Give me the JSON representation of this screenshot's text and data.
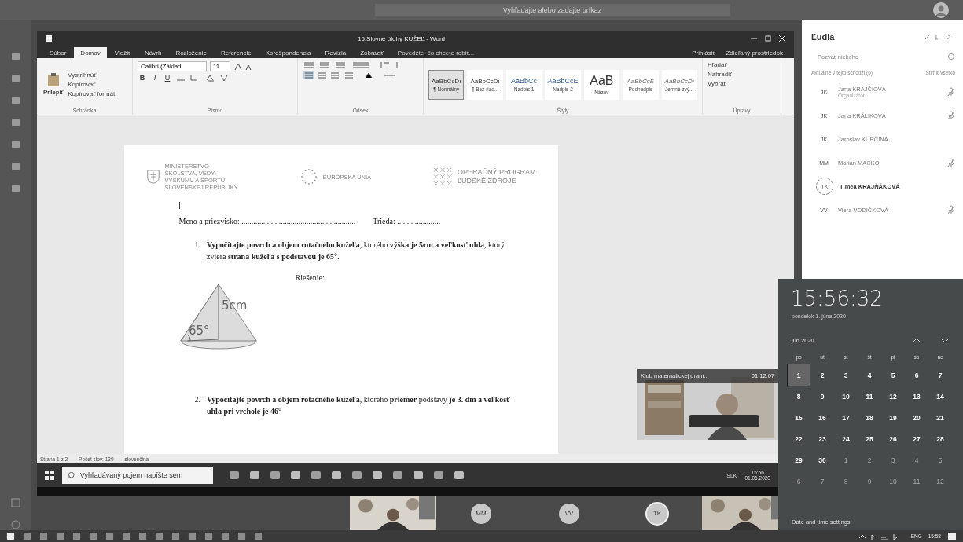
{
  "teams_bar": {
    "search": {
      "placeholder": "Vyhľadajte alebo zadajte príkaz"
    }
  },
  "word": {
    "title": "16.Slovné úlohy KUŽEĽ - Word",
    "tabs": [
      {
        "label": "Súbor",
        "selected": false
      },
      {
        "label": "Domov",
        "selected": true
      },
      {
        "label": "Vložiť",
        "selected": false
      },
      {
        "label": "Návrh",
        "selected": false
      },
      {
        "label": "Rozloženie",
        "selected": false
      },
      {
        "label": "Referencie",
        "selected": false
      },
      {
        "label": "Korešpondencia",
        "selected": false
      },
      {
        "label": "Revízia",
        "selected": false
      },
      {
        "label": "Zobraziť",
        "selected": false
      }
    ],
    "tell_me": "Povedzte, čo chcete robiť...",
    "sign_in": "Prihlásiť",
    "share": "Zdieľaný prostriedok",
    "clipboard": {
      "paste": "Prilepiť",
      "items": [
        "Vystrihnúť",
        "Kopírovať",
        "Kopírovať formát"
      ],
      "label": "Schránka"
    },
    "font": {
      "name": "Calibri (Základ",
      "size": "11",
      "format_buttons": [
        "B",
        "I",
        "U"
      ],
      "label": "Písmo"
    },
    "paragraph": {
      "label": "Odsek"
    },
    "styles": {
      "label": "Štýly",
      "items": [
        {
          "preview": "AaBbCcDı",
          "name": "¶ Normálny",
          "selected": true
        },
        {
          "preview": "AaBbCcDı",
          "name": "¶ Bez riad...",
          "selected": false
        },
        {
          "preview": "AaBbCc",
          "name": "Nadpis 1",
          "selected": false
        },
        {
          "preview": "AaBbCcE",
          "name": "Nadpis 2",
          "selected": false
        },
        {
          "preview": "AaB",
          "name": "Názov",
          "selected": false
        },
        {
          "preview": "AaBbCcE",
          "name": "Podnadpis",
          "selected": false
        },
        {
          "preview": "AaBbCcDı",
          "name": "Jemné zvý...",
          "selected": false
        }
      ]
    },
    "editing": {
      "label": "Úpravy",
      "items": [
        "Hľadať",
        "Nahradiť",
        "Vybrať"
      ]
    }
  },
  "document": {
    "logos": [
      {
        "kind": "ministry",
        "lines": [
          "MINISTERSTVO",
          "ŠKOLSTVA, VEDY,",
          "VÝSKUMU A ŠPORTU",
          "SLOVENSKEJ REPUBLIKY"
        ]
      },
      {
        "kind": "eu",
        "lines": [
          "EURÓPSKA ÚNIA"
        ]
      },
      {
        "kind": "program",
        "lines": [
          "OPERAČNÝ PROGRAM",
          "ĽUDSKÉ ZDROJE"
        ]
      }
    ],
    "name_line": "Meno a priezvisko: ..........................................................",
    "class_line": "Trieda: ......................",
    "tasks": [
      {
        "number": "1.",
        "text": "**Vypočítajte povrch a objem rotačného kužeľa**, ktorého **výška je 5cm a veľkosť uhla**, ktorý zviera **strana kužeľa s podstavou je 65°**."
      },
      {
        "number": "2.",
        "text": "**Vypočítajte povrch a objem rotačného kužeľa**, ktorého **priemer** podstavy **je 3. dm a veľkosť uhla pri vrchole je 46°**"
      }
    ],
    "solution_label": "Riešenie:",
    "cone_height": "5cm",
    "cone_angle": "65°"
  },
  "status_bar": [
    "Strana 1 z 2",
    "Počet slov: 139",
    "slovenčina"
  ],
  "shared_taskbar": {
    "search": {
      "placeholder": "Vyhľadávaný pojem napíšte sem"
    },
    "language": "SLK",
    "time": "15:56",
    "date": "01.06.2020"
  },
  "meeting_tile": {
    "title": "Klub matematickej gram...",
    "duration": "01:12:07"
  },
  "stage": [
    {
      "kind": "video"
    },
    {
      "kind": "avatar",
      "initials": "MM",
      "speaking": false
    },
    {
      "kind": "avatar",
      "initials": "VV",
      "speaking": false
    },
    {
      "kind": "avatar",
      "initials": "TK",
      "speaking": true
    },
    {
      "kind": "video"
    }
  ],
  "people": {
    "title": "Ľudia",
    "invite": "Pozvať niekoho",
    "section": "Aktuálne v tejto schôdzi (6)",
    "mute_all": "Stlmiť všetko",
    "participants": [
      {
        "initials": "JK",
        "name": "Jana KRAJČIOVÁ",
        "role": "Organizátor",
        "speaking": false,
        "mic": true
      },
      {
        "initials": "JK",
        "name": "Jana KRÁLIKOVÁ",
        "speaking": false,
        "mic": true
      },
      {
        "initials": "JK",
        "name": "Jaroslav KURČINA",
        "speaking": false,
        "mic": false
      },
      {
        "initials": "MM",
        "name": "Marián MACKO",
        "speaking": false,
        "mic": true
      },
      {
        "initials": "TK",
        "name": "Tímea KRAJŇÁKOVÁ",
        "speaking": true,
        "mic": false
      },
      {
        "initials": "VV",
        "name": "Viera VODIČKOVÁ",
        "speaking": false,
        "mic": true
      }
    ]
  },
  "calendar": {
    "time": "15:56:32",
    "date": "pondelok 1. júna 2020",
    "month": "jún 2020",
    "weekdays": [
      "po",
      "ut",
      "st",
      "št",
      "pi",
      "so",
      "ne"
    ],
    "days": [
      {
        "label": "1",
        "selected": true,
        "muted": false
      },
      {
        "label": "2",
        "selected": false,
        "muted": false
      },
      {
        "label": "3",
        "selected": false,
        "muted": false
      },
      {
        "label": "4",
        "selected": false,
        "muted": false
      },
      {
        "label": "5",
        "selected": false,
        "muted": false
      },
      {
        "label": "6",
        "selected": false,
        "muted": false
      },
      {
        "label": "7",
        "selected": false,
        "muted": false
      },
      {
        "label": "8",
        "selected": false,
        "muted": false
      },
      {
        "label": "9",
        "selected": false,
        "muted": false
      },
      {
        "label": "10",
        "selected": false,
        "muted": false
      },
      {
        "label": "11",
        "selected": false,
        "muted": false
      },
      {
        "label": "12",
        "selected": false,
        "muted": false
      },
      {
        "label": "13",
        "selected": false,
        "muted": false
      },
      {
        "label": "14",
        "selected": false,
        "muted": false
      },
      {
        "label": "15",
        "selected": false,
        "muted": false
      },
      {
        "label": "16",
        "selected": false,
        "muted": false
      },
      {
        "label": "17",
        "selected": false,
        "muted": false
      },
      {
        "label": "18",
        "selected": false,
        "muted": false
      },
      {
        "label": "19",
        "selected": false,
        "muted": false
      },
      {
        "label": "20",
        "selected": false,
        "muted": false
      },
      {
        "label": "21",
        "selected": false,
        "muted": false
      },
      {
        "label": "22",
        "selected": false,
        "muted": false
      },
      {
        "label": "23",
        "selected": false,
        "muted": false
      },
      {
        "label": "24",
        "selected": false,
        "muted": false
      },
      {
        "label": "25",
        "selected": false,
        "muted": false
      },
      {
        "label": "26",
        "selected": false,
        "muted": false
      },
      {
        "label": "27",
        "selected": false,
        "muted": false
      },
      {
        "label": "28",
        "selected": false,
        "muted": false
      },
      {
        "label": "29",
        "selected": false,
        "muted": false
      },
      {
        "label": "30",
        "selected": false,
        "muted": false
      },
      {
        "label": "1",
        "selected": false,
        "muted": true
      },
      {
        "label": "2",
        "selected": false,
        "muted": true
      },
      {
        "label": "3",
        "selected": false,
        "muted": true
      },
      {
        "label": "4",
        "selected": false,
        "muted": true
      },
      {
        "label": "5",
        "selected": false,
        "muted": true
      },
      {
        "label": "6",
        "selected": false,
        "muted": true
      },
      {
        "label": "7",
        "selected": false,
        "muted": true
      },
      {
        "label": "8",
        "selected": false,
        "muted": true
      },
      {
        "label": "9",
        "selected": false,
        "muted": true
      },
      {
        "label": "10",
        "selected": false,
        "muted": true
      },
      {
        "label": "11",
        "selected": false,
        "muted": true
      },
      {
        "label": "12",
        "selected": false,
        "muted": true
      }
    ],
    "settings_link": "Date and time settings",
    "tray_language": "ENG",
    "tray_time": "15:58"
  }
}
